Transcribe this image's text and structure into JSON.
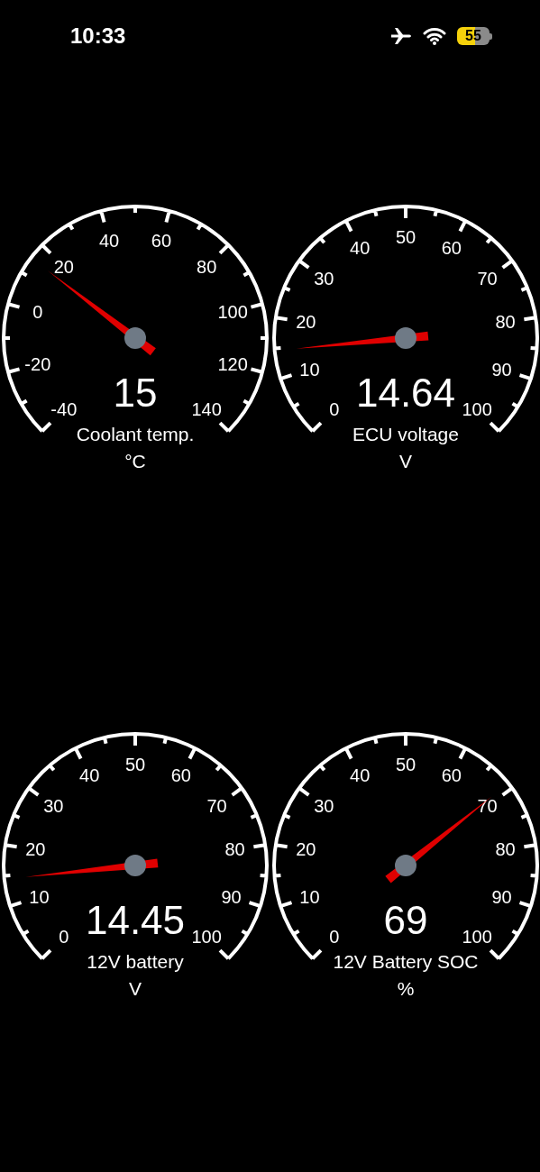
{
  "status_bar": {
    "time": "10:33",
    "battery": "55"
  },
  "gauges": [
    {
      "value": "15",
      "title": "Coolant temp.",
      "unit": "°C",
      "scale": [
        "-40",
        "-20",
        "0",
        "20",
        "40",
        "60",
        "80",
        "100",
        "120",
        "140"
      ]
    },
    {
      "value": "14.64",
      "title": "ECU voltage",
      "unit": "V",
      "scale": [
        "0",
        "10",
        "20",
        "30",
        "40",
        "50",
        "60",
        "70",
        "80",
        "90",
        "100"
      ]
    },
    {
      "value": "14.45",
      "title": "12V battery",
      "unit": "V",
      "scale": [
        "0",
        "10",
        "20",
        "30",
        "40",
        "50",
        "60",
        "70",
        "80",
        "90",
        "100"
      ]
    },
    {
      "value": "69",
      "title": "12V Battery SOC",
      "unit": "%",
      "scale": [
        "0",
        "10",
        "20",
        "30",
        "40",
        "50",
        "60",
        "70",
        "80",
        "90",
        "100"
      ]
    }
  ]
}
